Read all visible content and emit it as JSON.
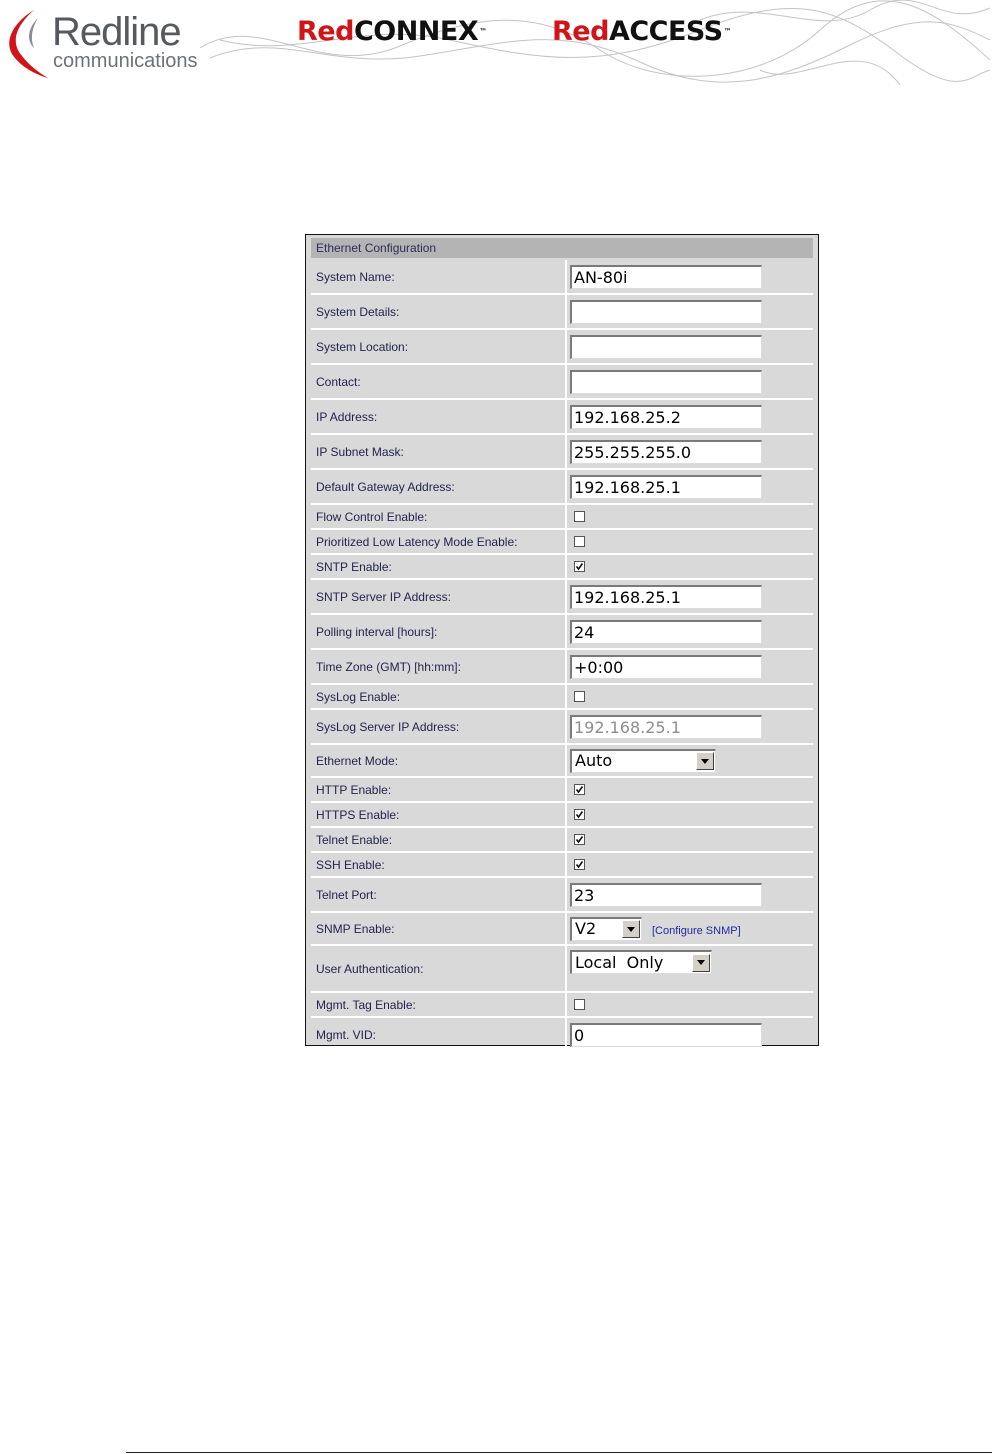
{
  "header": {
    "logo_word": "Redline",
    "logo_sub": "communications",
    "brand1_red": "Red",
    "brand1_black": "CONNEX",
    "brand2_red": "Red",
    "brand2_black": "ACCESS",
    "trademark": "™"
  },
  "colors": {
    "brand_red": "#d01418",
    "label_text": "#23234f",
    "link": "#1d2a9e",
    "panel_bg": "#d9d9d9",
    "panel_header_bg": "#b4b4b4"
  },
  "config": {
    "title": "Ethernet Configuration",
    "rows": [
      {
        "label": "System Name:",
        "type": "text",
        "value": "AN-80i"
      },
      {
        "label": "System Details:",
        "type": "text",
        "value": ""
      },
      {
        "label": "System Location:",
        "type": "text",
        "value": ""
      },
      {
        "label": "Contact:",
        "type": "text",
        "value": ""
      },
      {
        "label": "IP Address:",
        "type": "text",
        "value": "192.168.25.2"
      },
      {
        "label": "IP Subnet Mask:",
        "type": "text",
        "value": "255.255.255.0"
      },
      {
        "label": "Default Gateway Address:",
        "type": "text",
        "value": "192.168.25.1"
      },
      {
        "label": "Flow Control Enable:",
        "type": "checkbox",
        "checked": false
      },
      {
        "label": "Prioritized Low Latency Mode Enable:",
        "type": "checkbox",
        "checked": false
      },
      {
        "label": "SNTP Enable:",
        "type": "checkbox",
        "checked": true
      },
      {
        "label": "SNTP Server IP Address:",
        "type": "text",
        "value": "192.168.25.1"
      },
      {
        "label": "Polling interval [hours]:",
        "type": "text",
        "value": "24"
      },
      {
        "label": "Time Zone (GMT) [hh:mm]:",
        "type": "text",
        "value": "+0:00"
      },
      {
        "label": "SysLog Enable:",
        "type": "checkbox",
        "checked": false
      },
      {
        "label": "SysLog Server IP Address:",
        "type": "text",
        "value": "192.168.25.1",
        "disabled": true
      },
      {
        "label": "Ethernet Mode:",
        "type": "select",
        "value": "Auto"
      },
      {
        "label": "HTTP Enable:",
        "type": "checkbox",
        "checked": true
      },
      {
        "label": "HTTPS Enable:",
        "type": "checkbox",
        "checked": true
      },
      {
        "label": "Telnet Enable:",
        "type": "checkbox",
        "checked": true
      },
      {
        "label": "SSH Enable:",
        "type": "checkbox",
        "checked": true
      },
      {
        "label": "Telnet Port:",
        "type": "text",
        "value": "23"
      },
      {
        "label": "SNMP Enable:",
        "type": "select",
        "value": "V2",
        "link": "[Configure SNMP]"
      },
      {
        "label": "User Authentication:",
        "type": "select",
        "value": "Local  Only"
      },
      {
        "label": "Mgmt. Tag Enable:",
        "type": "checkbox",
        "checked": false
      },
      {
        "label": "Mgmt. VID:",
        "type": "text",
        "value": "0"
      }
    ]
  }
}
